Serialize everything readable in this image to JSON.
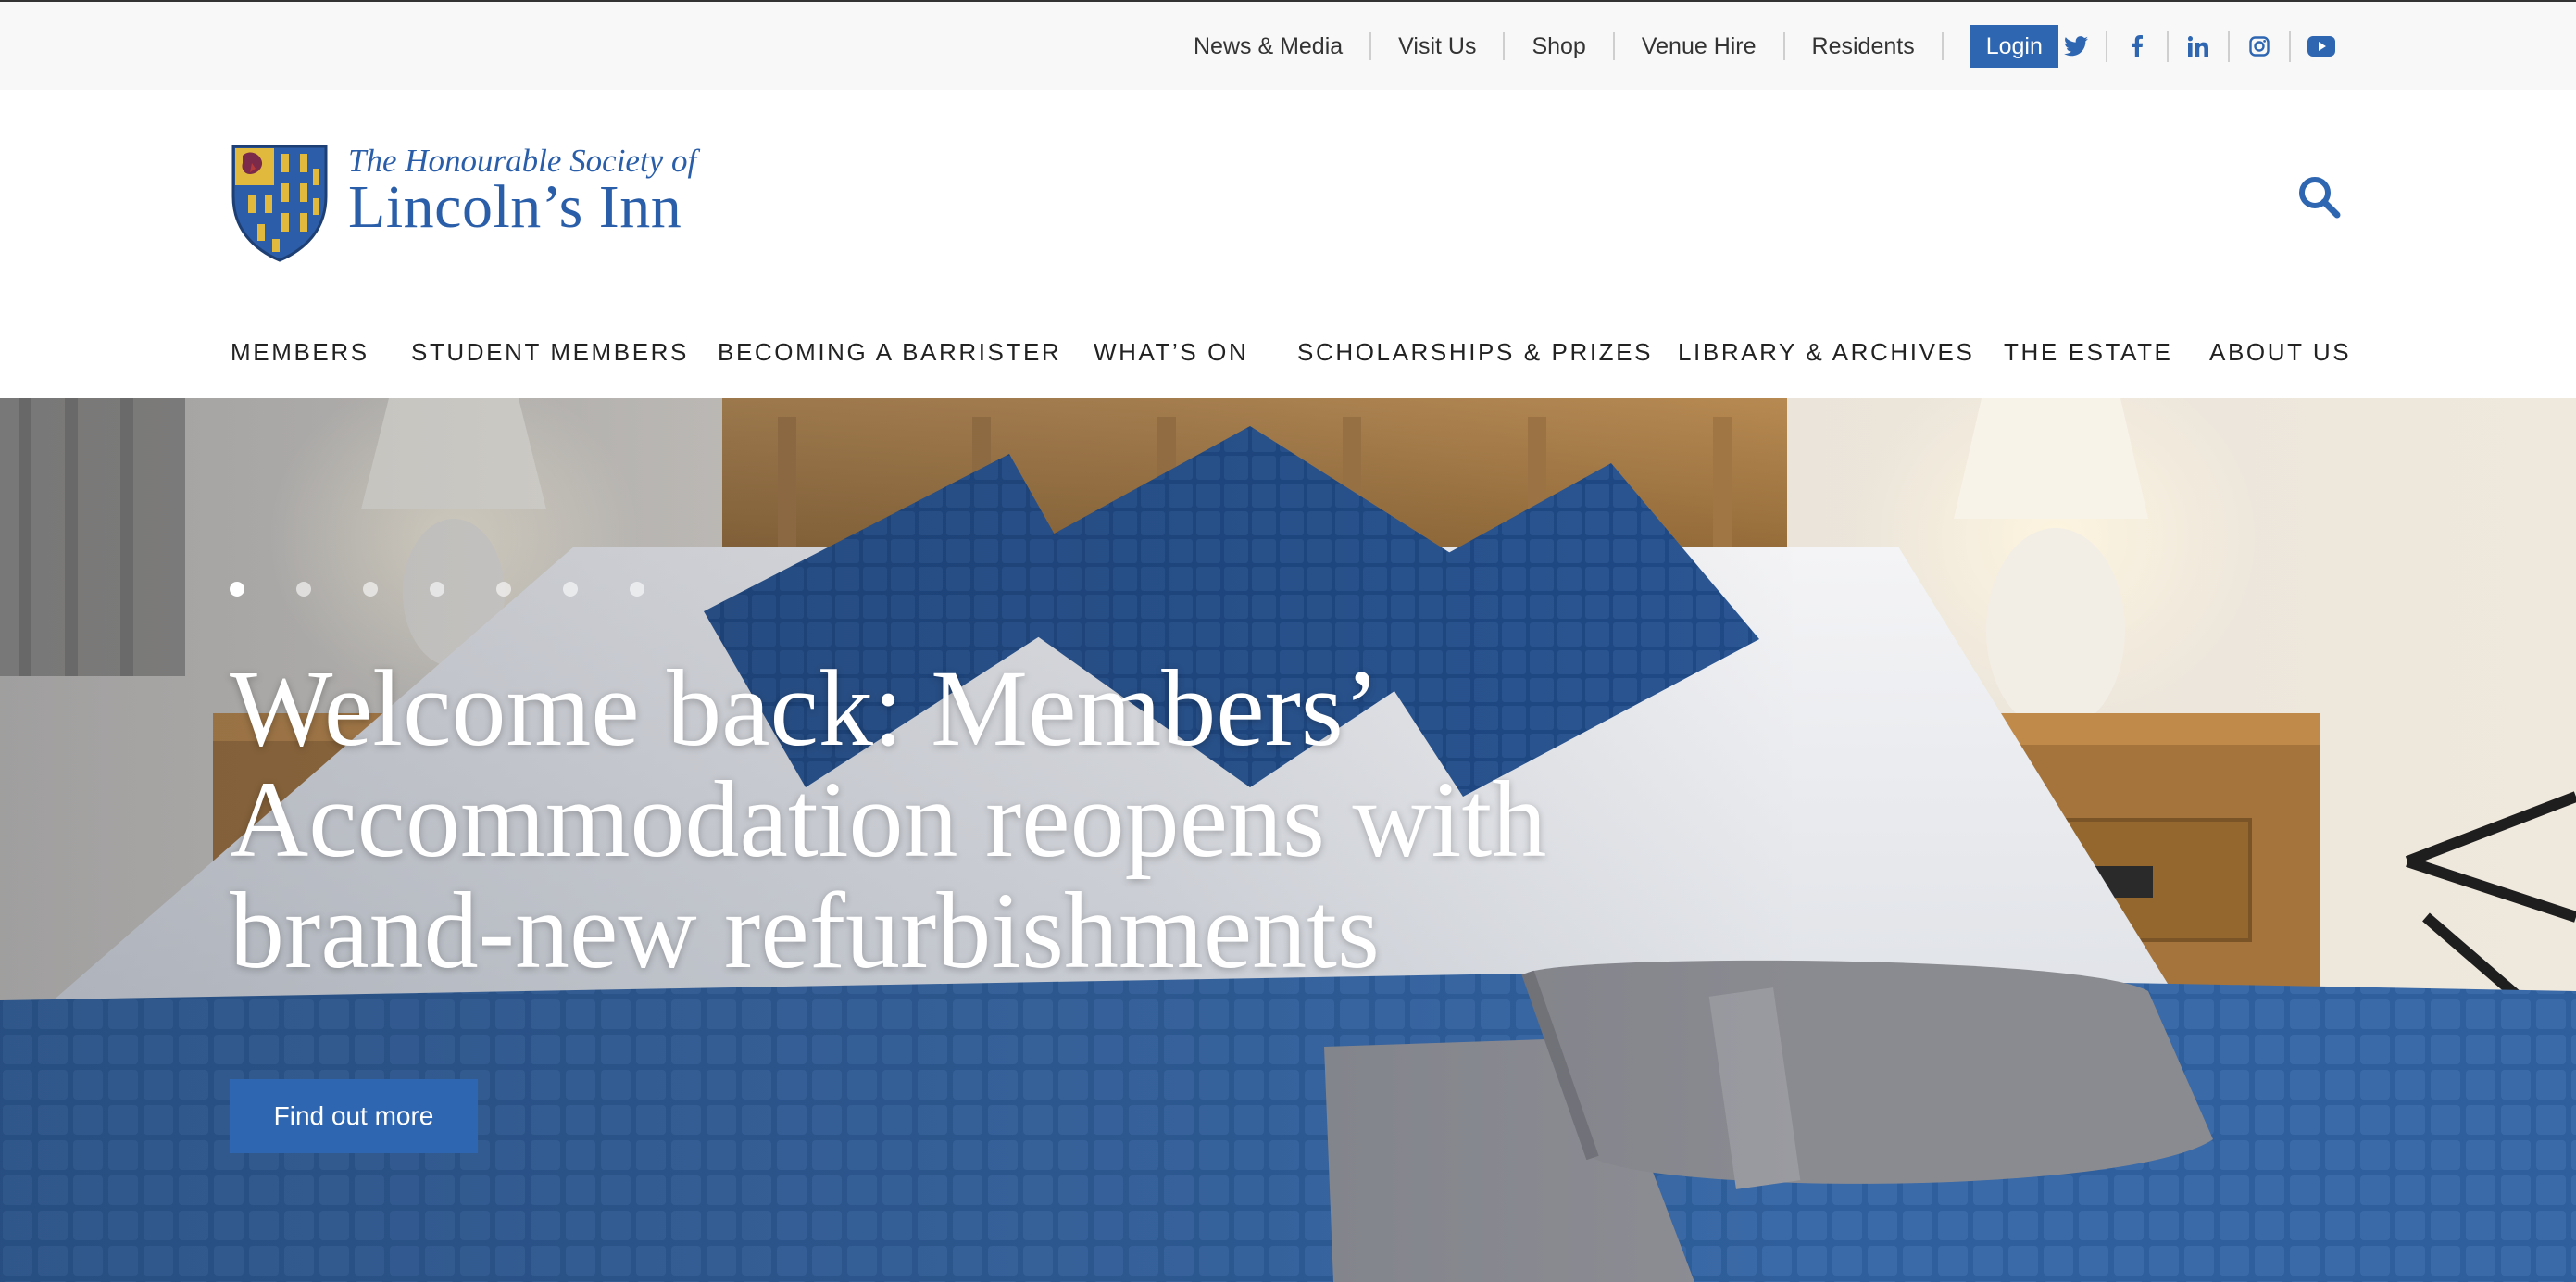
{
  "utility_nav": {
    "links": [
      "News & Media",
      "Visit Us",
      "Shop",
      "Venue Hire",
      "Residents"
    ],
    "login_label": "Login"
  },
  "social": {
    "icons": [
      "twitter-icon",
      "facebook-icon",
      "linkedin-icon",
      "instagram-icon",
      "youtube-icon"
    ]
  },
  "logo": {
    "line1": "The Honourable Society of",
    "line2": "Lincoln’s Inn"
  },
  "main_nav": {
    "items": [
      "Members",
      "Student Members",
      "Becoming a Barrister",
      "What’s On",
      "Scholarships & Prizes",
      "Library & Archives",
      "The Estate",
      "About Us"
    ]
  },
  "hero": {
    "slide_count": 7,
    "active_slide": 1,
    "title": "Welcome back: Members’ Accommodation reopens with brand-new refurbishments",
    "cta_label": "Find out more"
  },
  "colors": {
    "brand_blue": "#2e66b2",
    "logo_blue": "#2a5ea9",
    "utility_bg": "#f8f8f8"
  }
}
